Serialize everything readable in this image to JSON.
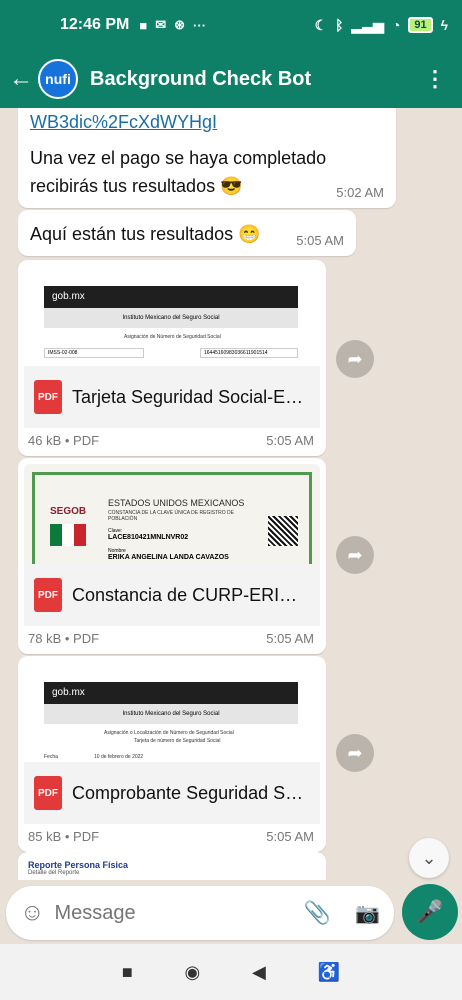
{
  "status_bar": {
    "time": "12:46 PM",
    "battery": "91"
  },
  "header": {
    "title": "Background Check Bot",
    "avatar_text": "nufi"
  },
  "messages": [
    {
      "text": "WB3dic%2FcXdWYHgI"
    },
    {
      "text": "Una vez el pago se haya completado recibirás tus resultados 😎",
      "time": "5:02 AM"
    },
    {
      "text": "Aquí están tus resultados 😁",
      "time": "5:05 AM"
    }
  ],
  "documents": [
    {
      "name": "Tarjeta Seguridad Social-ERI...",
      "meta": "46 kB • PDF",
      "time": "5:05 AM",
      "preview": {
        "brand": "gob.mx",
        "header": "Instituto Mexicano del Seguro Social",
        "line1": "Asignación de Número de Seguridad Social",
        "box1": "IMSS-02-008",
        "box2": "16445160983036611901514"
      }
    },
    {
      "name": "Constancia de CURP-ERIKA...",
      "meta": "78 kB • PDF",
      "time": "5:05 AM",
      "preview": {
        "agency": "SEGOB",
        "title": "ESTADOS UNIDOS MEXICANOS",
        "subtitle": "CONSTANCIA DE LA CLAVE ÚNICA DE REGISTRO DE POBLACIÓN",
        "clave_label": "Clave:",
        "clave": "LACE810421MNLNVR02",
        "nombre_label": "Nombre",
        "nombre": "ERIKA ANGELINA LANDA CAVAZOS"
      }
    },
    {
      "name": "Comprobante Seguridad So...",
      "meta": "85 kB • PDF",
      "time": "5:05 AM",
      "preview": {
        "brand": "gob.mx",
        "header": "Instituto Mexicano del Seguro Social",
        "line1": "Asignación o Localización de Número de Seguridad Social",
        "line2": "Tarjeta de número de Seguridad Social",
        "fecha_label": "Fecha",
        "fecha": "10 de febrero de 2022"
      }
    },
    {
      "name": "Reporte Persona Física",
      "preview": {
        "subtitle": "Detalle del Reporte"
      }
    }
  ],
  "input": {
    "placeholder": "Message"
  },
  "icons": {
    "emoji": "emoji-icon",
    "attach": "paperclip-icon",
    "camera": "camera-icon",
    "mic": "mic-icon"
  },
  "colors": {
    "header": "#0d8067",
    "accent": "#11866d"
  }
}
